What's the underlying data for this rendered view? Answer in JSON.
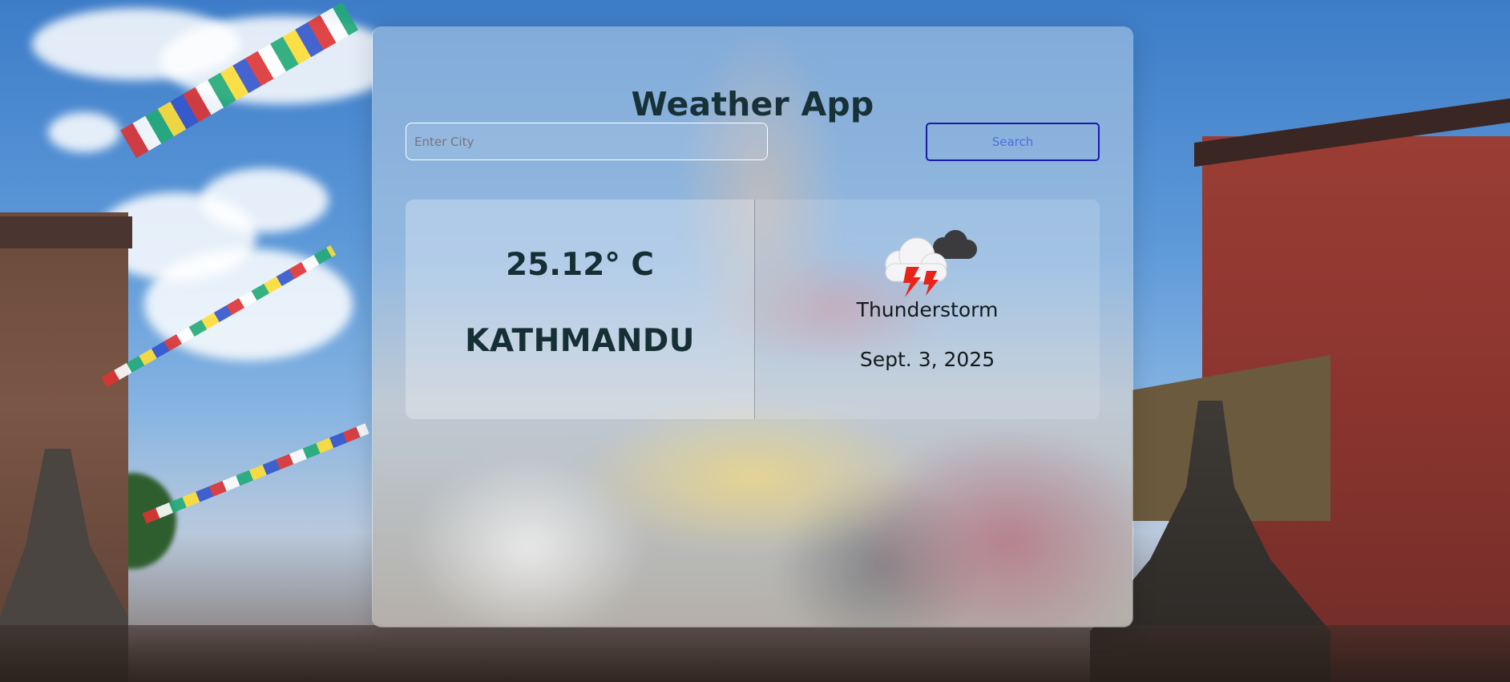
{
  "app": {
    "title": "Weather App"
  },
  "search": {
    "placeholder": "Enter City",
    "value": "",
    "button_label": "Search"
  },
  "weather": {
    "temperature": "25.12° C",
    "city": "KATHMANDU",
    "condition": "Thunderstorm",
    "condition_icon": "thunderstorm-icon",
    "date": "Sept. 3, 2025"
  },
  "colors": {
    "title_text": "#163238",
    "search_border": "#1a1aa8",
    "search_text": "#4d6ee0",
    "lightning": "#e8241a"
  }
}
